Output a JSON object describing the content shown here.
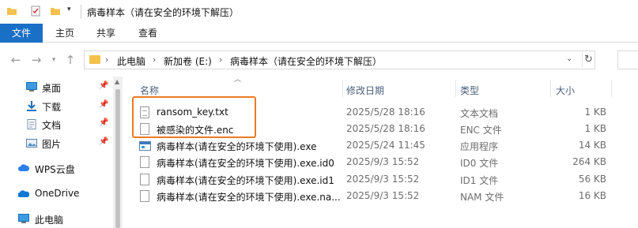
{
  "window": {
    "title": "病毒样本（请在安全的环境下解压）"
  },
  "ribbon": {
    "tabs": [
      "文件",
      "主页",
      "共享",
      "查看"
    ]
  },
  "address": {
    "crumbs": [
      "此电脑",
      "新加卷 (E:)",
      "病毒样本（请在安全的环境下解压）"
    ]
  },
  "nav": {
    "items": [
      {
        "label": "桌面",
        "icon": "desktop-icon",
        "pinned": true
      },
      {
        "label": "下载",
        "icon": "download-icon",
        "pinned": true
      },
      {
        "label": "文档",
        "icon": "documents-icon",
        "pinned": true
      },
      {
        "label": "图片",
        "icon": "pictures-icon",
        "pinned": true
      },
      {
        "label": "WPS云盘",
        "icon": "wps-cloud-icon",
        "pinned": false
      },
      {
        "label": "OneDrive",
        "icon": "onedrive-icon",
        "pinned": false
      },
      {
        "label": "此电脑",
        "icon": "this-pc-icon",
        "pinned": false
      }
    ]
  },
  "list": {
    "headers": {
      "name": "名称",
      "date": "修改日期",
      "type": "类型",
      "size": "大小"
    },
    "files": [
      {
        "name": "ransom_key.txt",
        "date": "2025/5/28 18:16",
        "type": "文本文档",
        "size": "1 KB",
        "icon": "text-file-icon"
      },
      {
        "name": "被感染的文件.enc",
        "date": "2025/5/28 18:16",
        "type": "ENC 文件",
        "size": "1 KB",
        "icon": "file-icon"
      },
      {
        "name": "病毒样本(请在安全的环境下使用).exe",
        "date": "2025/5/24 11:45",
        "type": "应用程序",
        "size": "14 KB",
        "icon": "exe-icon"
      },
      {
        "name": "病毒样本(请在安全的环境下使用).exe.id0",
        "date": "2025/9/3 15:52",
        "type": "ID0 文件",
        "size": "264 KB",
        "icon": "file-icon"
      },
      {
        "name": "病毒样本(请在安全的环境下使用).exe.id1",
        "date": "2025/9/3 15:52",
        "type": "ID1 文件",
        "size": "56 KB",
        "icon": "file-icon"
      },
      {
        "name": "病毒样本(请在安全的环境下使用).exe.na...",
        "date": "2025/9/3 15:52",
        "type": "NAM 文件",
        "size": "16 KB",
        "icon": "file-icon"
      }
    ]
  },
  "colors": {
    "accent": "#1a6fc6",
    "highlight": "#ec7a23",
    "folder": "#f4c24d"
  }
}
